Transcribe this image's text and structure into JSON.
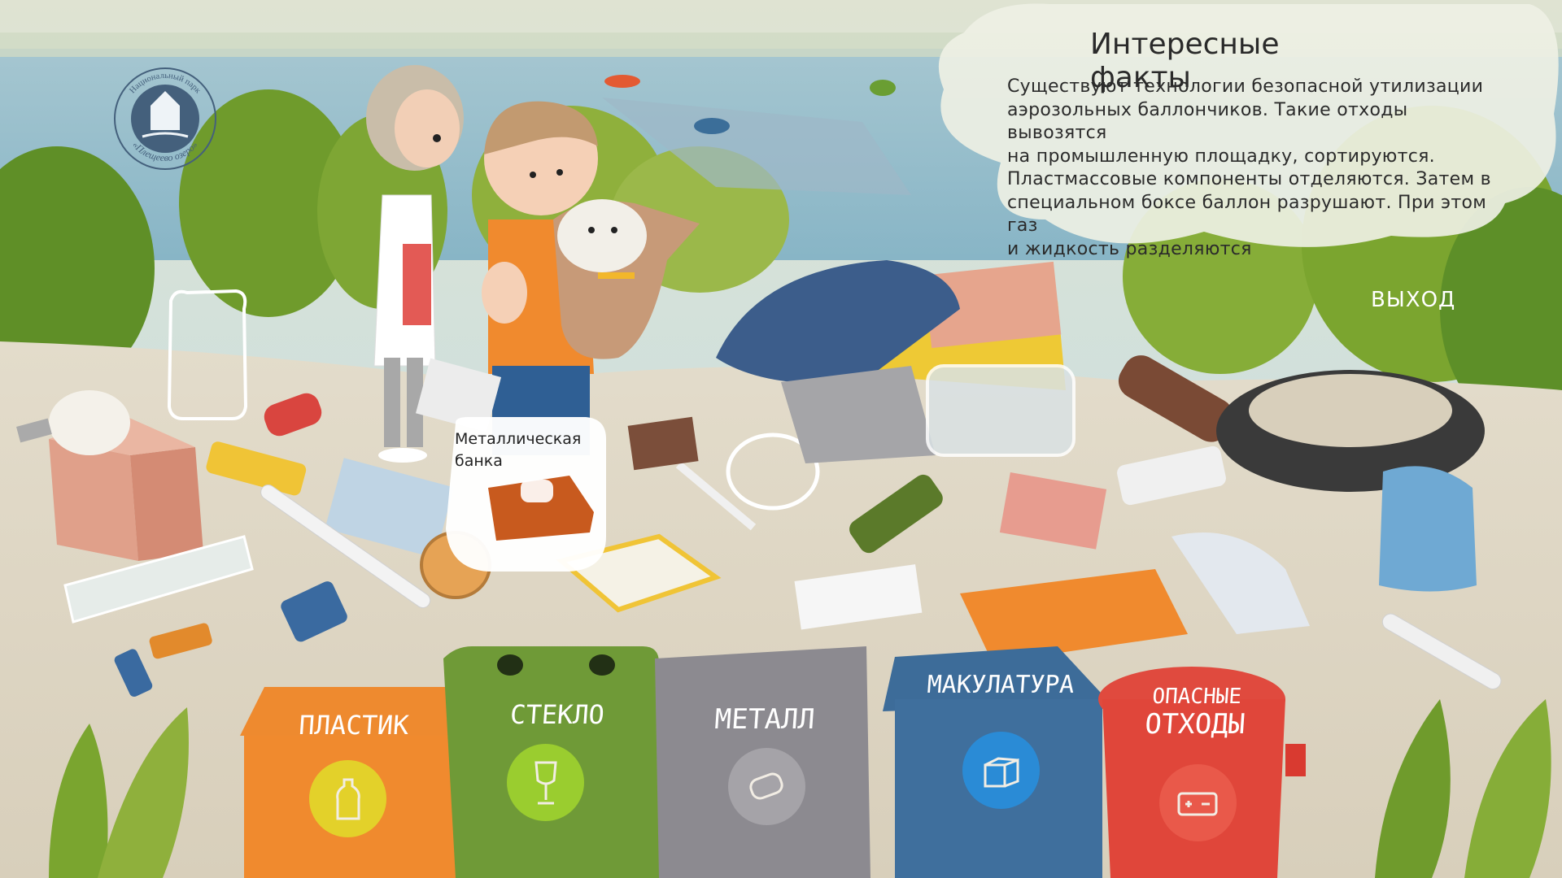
{
  "logo": {
    "text_top": "Национальный парк",
    "text_bottom": "«Плещеево озеро»"
  },
  "info": {
    "title": "Интересные факты",
    "lines": [
      "Существуют технологии безопасной утилизации",
      "аэрозольных баллончиков. Такие отходы вывозятся",
      "на промышленную площадку, сортируются.",
      "Пластмассовые компоненты отделяются. Затем в",
      "специальном боксе баллон разрушают. При этом газ",
      "и жидкость разделяются"
    ]
  },
  "exit_label": "ВЫХОД",
  "selected_item": {
    "lines": [
      "Металлическая",
      "банка"
    ]
  },
  "bins": [
    {
      "label": "ПЛАСТИК",
      "color": "#f08a2e",
      "icon": "plastic-bottle-icon"
    },
    {
      "label": "СТЕКЛО",
      "color": "#6e9a36",
      "icon": "glass-icon"
    },
    {
      "label": "МЕТАЛЛ",
      "color": "#8f8d92",
      "icon": "tin-can-icon"
    },
    {
      "label": "МАКУЛАТУРА",
      "color": "#3f6f9d",
      "icon": "paper-box-icon"
    },
    {
      "label_lines": [
        "ОПАСНЫЕ",
        "ОТХОДЫ"
      ],
      "color": "#e0463a",
      "icon": "battery-icon"
    }
  ]
}
